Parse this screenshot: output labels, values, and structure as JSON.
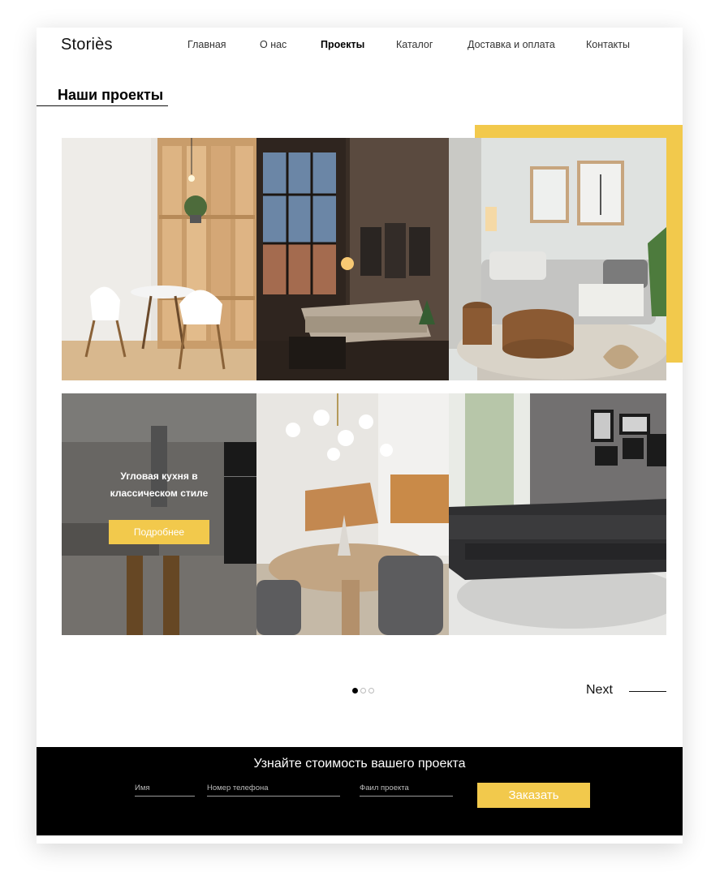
{
  "brand": "Storiès",
  "nav": [
    {
      "label": "Главная",
      "active": false
    },
    {
      "label": "О нас",
      "active": false
    },
    {
      "label": "Проекты",
      "active": true
    },
    {
      "label": "Каталог",
      "active": false
    },
    {
      "label": "Доставка и оплата",
      "active": false
    },
    {
      "label": "Контакты",
      "active": false
    }
  ],
  "section_title": "Наши проекты",
  "gallery": {
    "photos": [
      {
        "icon": "dining-room-photo"
      },
      {
        "icon": "loft-living-room-photo"
      },
      {
        "icon": "sofa-living-room-photo"
      },
      {
        "icon": "kitchen-photo"
      },
      {
        "icon": "round-table-dining-photo"
      },
      {
        "icon": "black-corner-sofa-photo"
      }
    ],
    "overlay": {
      "text_line1": "Угловая кухня в",
      "text_line2": "классическом стиле",
      "button_label": "Подробнее"
    }
  },
  "pager": {
    "total": 3,
    "active": 1,
    "next_label": "Next"
  },
  "footer": {
    "title": "Узнайте стоимость вашего проекта",
    "name_placeholder": "Имя",
    "phone_placeholder": "Номер телефона",
    "file_placeholder": "Фаил проекта",
    "order_label": "Заказать"
  },
  "colors": {
    "accent": "#F2C94C",
    "footer_bg": "#000000",
    "text": "#111111"
  }
}
